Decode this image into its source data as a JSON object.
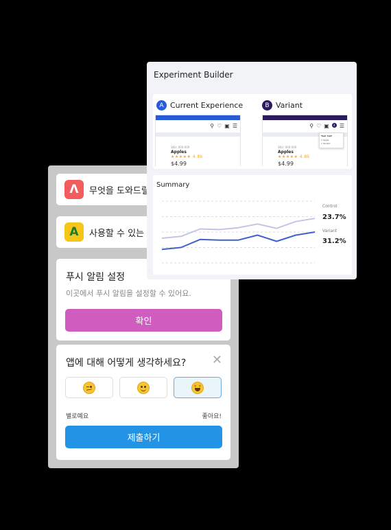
{
  "mobile": {
    "notifications": [
      {
        "icon": "Λ",
        "text": "무엇을 도와드릴",
        "icon_bg": "#f25c5c",
        "icon_fg": "#ffffff"
      },
      {
        "icon": "A",
        "text": "사용할 수 있는",
        "icon_bg": "#f5c518",
        "icon_fg": "#1b7a2e"
      }
    ],
    "push": {
      "title": "푸시 알림 설정",
      "description": "이곳에서 푸시 알림을 설정할 수 있어요.",
      "button": "확인",
      "button_color": "#d05cbf"
    },
    "survey": {
      "question": "앱에 대해 어떻게 생각하세요?",
      "close": "✕",
      "options": [
        "neutral-face",
        "smile-face",
        "star-eyes-face"
      ],
      "selected_index": 2,
      "scale_low": "별로예요",
      "scale_high": "좋아요!",
      "submit": "제출하기",
      "submit_color": "#2393e6"
    }
  },
  "experiment": {
    "title": "Experiment Builder",
    "variants": [
      {
        "badge": "A",
        "label": "Current Experience",
        "color": "#2a5bd7",
        "mock": {
          "sku": "SKU: 000-000",
          "product": "Apples",
          "stars": "★★★★★ 4.8k",
          "price": "$4.99"
        }
      },
      {
        "badge": "B",
        "label": "Variant",
        "color": "#2a1a5e",
        "mock": {
          "sku": "SKU: 000-000",
          "product": "Apples",
          "stars": "★★★★★ 4.8k",
          "price": "$4.99",
          "cart_count": "4",
          "cart_title": "Your Cart",
          "cart_item1": "1  Apple",
          "cart_item2": "1  Variant"
        }
      }
    ],
    "summary": {
      "title": "Summary",
      "legend": [
        {
          "name": "Control",
          "value": "23.7%",
          "color": "#c5c3e6"
        },
        {
          "name": "Variant",
          "value": "31.2%",
          "color": "#3b62c9"
        }
      ]
    }
  },
  "chart_data": {
    "type": "line",
    "title": "Summary",
    "x": [
      0,
      1,
      2,
      3,
      4,
      5,
      6,
      7,
      8
    ],
    "series": [
      {
        "name": "Control",
        "values": [
          40,
          43,
          55,
          54,
          57,
          63,
          56,
          67,
          72
        ]
      },
      {
        "name": "Variant",
        "values": [
          22,
          25,
          38,
          37,
          37,
          45,
          35,
          45,
          50
        ]
      }
    ],
    "ylim": [
      0,
      100
    ],
    "grid": true
  }
}
